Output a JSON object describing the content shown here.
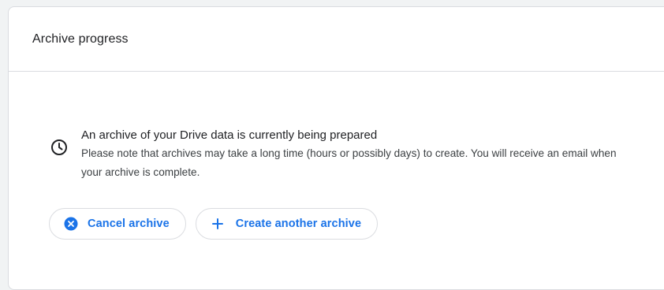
{
  "card": {
    "title": "Archive progress"
  },
  "status": {
    "icon": "clock-icon",
    "headline": "An archive of your Drive data is currently being prepared",
    "note": "Please note that archives may take a long time (hours or possibly days) to create. You will receive an email when your archive is complete."
  },
  "actions": {
    "cancel_label": "Cancel archive",
    "cancel_icon": "cancel-circle-icon",
    "create_label": "Create another archive",
    "create_icon": "plus-icon"
  },
  "colors": {
    "accent": "#1a73e8",
    "text_primary": "#202124",
    "text_secondary": "#3c4043",
    "border": "#dadce0"
  }
}
